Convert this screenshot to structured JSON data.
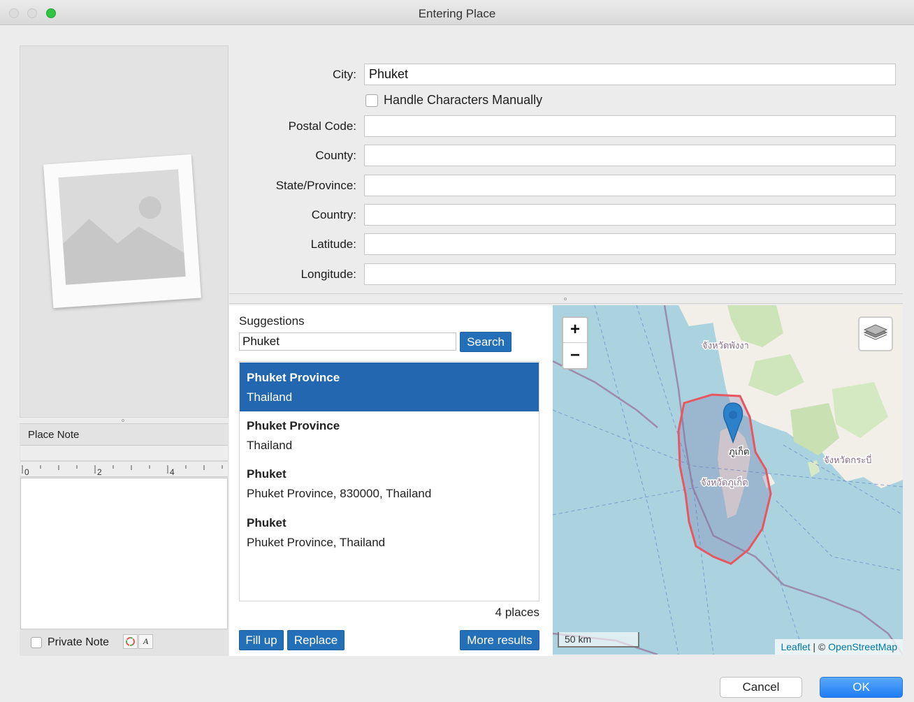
{
  "window": {
    "title": "Entering Place"
  },
  "form": {
    "city_label": "City:",
    "city_value": "Phuket",
    "handle_chars_label": "Handle Characters Manually",
    "postal_label": "Postal Code:",
    "postal_value": "",
    "county_label": "County:",
    "county_value": "",
    "state_label": "State/Province:",
    "state_value": "",
    "country_label": "Country:",
    "country_value": "",
    "latitude_label": "Latitude:",
    "latitude_value": "",
    "longitude_label": "Longitude:",
    "longitude_value": ""
  },
  "note": {
    "label": "Place Note",
    "ruler_ticks": [
      "0",
      "2",
      "4"
    ],
    "private_label": "Private Note",
    "format_btn": "A"
  },
  "suggestions": {
    "title": "Suggestions",
    "search_value": "Phuket",
    "search_button": "Search",
    "results": [
      {
        "name": "Phuket Province",
        "detail": "Thailand",
        "selected": true
      },
      {
        "name": "Phuket Province",
        "detail": "Thailand",
        "selected": false
      },
      {
        "name": "Phuket",
        "detail": "Phuket Province, 830000, Thailand",
        "selected": false
      },
      {
        "name": "Phuket",
        "detail": "Phuket Province, Thailand",
        "selected": false
      }
    ],
    "count_text": "4 places",
    "fill_up_button": "Fill up",
    "replace_button": "Replace",
    "more_results_button": "More results"
  },
  "map": {
    "zoom_in": "+",
    "zoom_out": "−",
    "labels": {
      "phangnga": "จังหวัดพังงา",
      "phuket_city": "ภูเก็ต",
      "phuket_province": "จังหวัดภูเก็ต",
      "krabi": "จังหวัดกระบี่"
    },
    "scale": "50 km",
    "attribution_leaflet": "Leaflet",
    "attribution_sep": " | © ",
    "attribution_osm": "OpenStreetMap",
    "colors": {
      "sea": "#aad3df",
      "land": "#f2efe9",
      "boundary": "#e8565f",
      "marker": "#2b82cb"
    }
  },
  "dialog": {
    "cancel": "Cancel",
    "ok": "OK"
  }
}
